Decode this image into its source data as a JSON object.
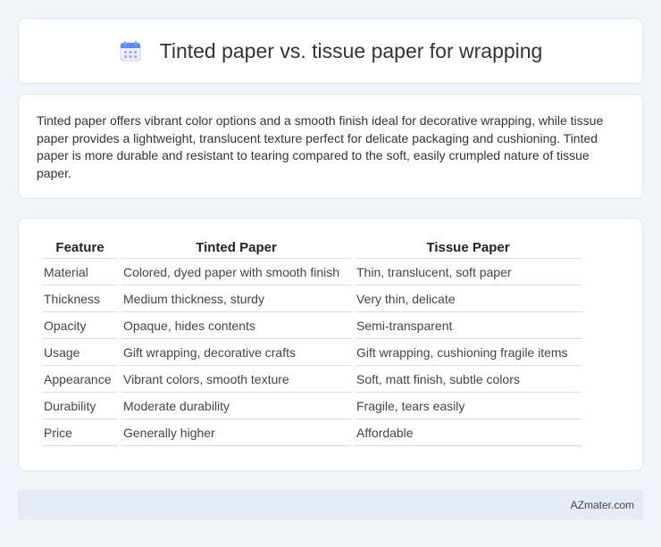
{
  "header": {
    "icon": "calendar-icon",
    "title": "Tinted paper vs. tissue paper for wrapping"
  },
  "summary": {
    "text": "Tinted paper offers vibrant color options and a smooth finish ideal for decorative wrapping, while tissue paper provides a lightweight, translucent texture perfect for delicate packaging and cushioning. Tinted paper is more durable and resistant to tearing compared to the soft, easily crumpled nature of tissue paper."
  },
  "table": {
    "headers": [
      "Feature",
      "Tinted Paper",
      "Tissue Paper"
    ],
    "rows": [
      [
        "Material",
        "Colored, dyed paper with smooth finish",
        "Thin, translucent, soft paper"
      ],
      [
        "Thickness",
        "Medium thickness, sturdy",
        "Very thin, delicate"
      ],
      [
        "Opacity",
        "Opaque, hides contents",
        "Semi-transparent"
      ],
      [
        "Usage",
        "Gift wrapping, decorative crafts",
        "Gift wrapping, cushioning fragile items"
      ],
      [
        "Appearance",
        "Vibrant colors, smooth texture",
        "Soft, matt finish, subtle colors"
      ],
      [
        "Durability",
        "Moderate durability",
        "Fragile, tears easily"
      ],
      [
        "Price",
        "Generally higher",
        "Affordable"
      ]
    ]
  },
  "footer": {
    "brand": "AZmater.com"
  },
  "colors": {
    "background": "#f1f4f9",
    "card": "#ffffff",
    "icon_accent": "#5b8def",
    "footer_bg": "#e5ebf4"
  }
}
